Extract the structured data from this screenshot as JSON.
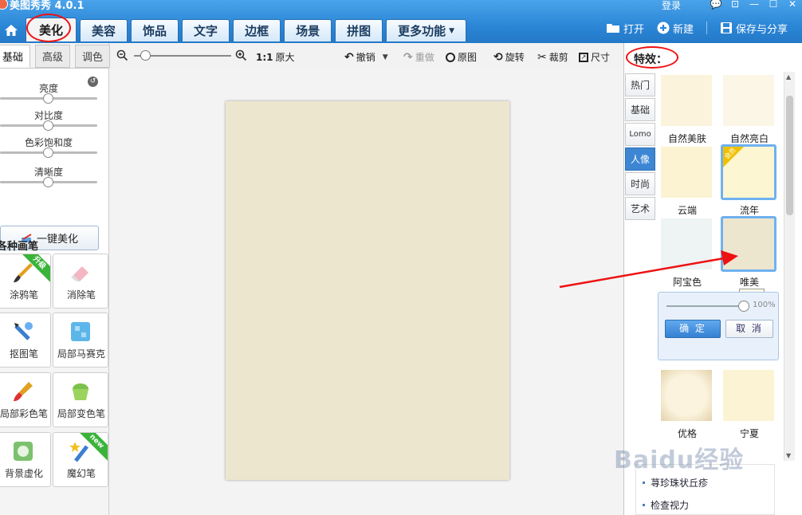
{
  "app": {
    "title": "美图秀秀 4.0.1",
    "login": "登录"
  },
  "window_controls": [
    "💬",
    "⊡",
    "—",
    "☐",
    "✕"
  ],
  "tabs": [
    {
      "label": "美化",
      "active": true
    },
    {
      "label": "美容"
    },
    {
      "label": "饰品"
    },
    {
      "label": "文字"
    },
    {
      "label": "边框"
    },
    {
      "label": "场景"
    },
    {
      "label": "拼图"
    },
    {
      "label": "更多功能"
    }
  ],
  "top_actions": {
    "open": "打开",
    "new": "新建",
    "save": "保存与分享"
  },
  "left_tabs": [
    "基础",
    "高级",
    "调色"
  ],
  "sliders": [
    {
      "label": "亮度",
      "value": 0.5
    },
    {
      "label": "对比度",
      "value": 0.5
    },
    {
      "label": "色彩饱和度",
      "value": 0.5
    },
    {
      "label": "清晰度",
      "value": 0.5
    }
  ],
  "one_key": "一键美化",
  "brushes_title": "各种画笔",
  "brushes": [
    {
      "label": "涂鸦笔",
      "badge": "升级"
    },
    {
      "label": "消除笔"
    },
    {
      "label": "抠图笔"
    },
    {
      "label": "局部马赛克"
    },
    {
      "label": "局部彩色笔"
    },
    {
      "label": "局部变色笔"
    },
    {
      "label": "背景虚化"
    },
    {
      "label": "魔幻笔",
      "badge": "new"
    }
  ],
  "toolbar": {
    "ratio": "1:1",
    "original_size": "原大",
    "undo": "撤销",
    "redo": "重做",
    "original": "原图",
    "rotate": "旋转",
    "crop": "裁剪",
    "resize": "尺寸"
  },
  "effects": {
    "title": "特效：",
    "categories": [
      "热门",
      "基础",
      "Lomo",
      "人像",
      "时尚",
      "艺术"
    ],
    "active_category": "人像",
    "items": [
      {
        "label": "自然美肤",
        "color": "#fbf3dc"
      },
      {
        "label": "自然亮白",
        "color": "#fcf6e6"
      },
      {
        "label": "云端",
        "color": "#fbf3d2"
      },
      {
        "label": "流年",
        "color": "#fdf6d3",
        "badge": "会员"
      },
      {
        "label": "阿宝色",
        "color": "#eef3f4"
      },
      {
        "label": "唯美",
        "color": "#ede6cf",
        "selected": true
      },
      {
        "label": "优格",
        "color": "#f7ecd0"
      },
      {
        "label": "宁夏",
        "color": "#fcf3d4"
      }
    ],
    "tooltip": "唯美",
    "opacity": "100%",
    "confirm": "确 定",
    "cancel": "取 消"
  },
  "news": [
    "荨珍珠状丘疹",
    "检查视力"
  ],
  "watermark": "Baidu经验",
  "canvas": {
    "photo_color": "#ede6cf"
  }
}
